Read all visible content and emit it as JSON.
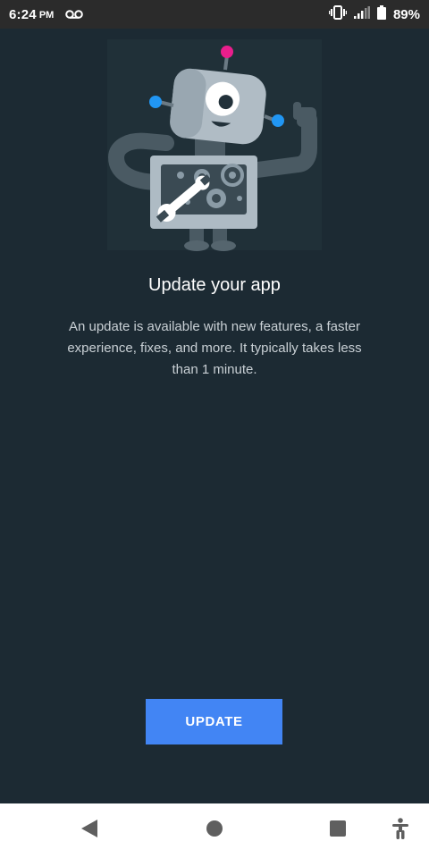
{
  "status_bar": {
    "time": "6:24",
    "ampm": "PM",
    "voicemail_icon": "voicemail-icon",
    "vibrate_icon": "vibrate-icon",
    "signal_icon": "signal-icon",
    "battery_icon": "battery-icon",
    "battery_percent": "89%"
  },
  "content": {
    "illustration": "robot-repair-illustration",
    "title": "Update your app",
    "description": "An update is available with new features, a faster experience, fixes, and more. It typically takes less than 1 minute.",
    "button_label": "UPDATE"
  },
  "nav_bar": {
    "back_icon": "back-icon",
    "home_icon": "home-icon",
    "recents_icon": "recents-icon",
    "accessibility_icon": "accessibility-icon"
  },
  "colors": {
    "background": "#1c2a33",
    "status_bar": "#2b2b2b",
    "accent_button": "#4285f4",
    "nav_bar": "#ffffff",
    "robot_body": "#b0bcc5",
    "robot_pink_antenna": "#e91e8c",
    "robot_blue_bolts": "#2196f3"
  }
}
